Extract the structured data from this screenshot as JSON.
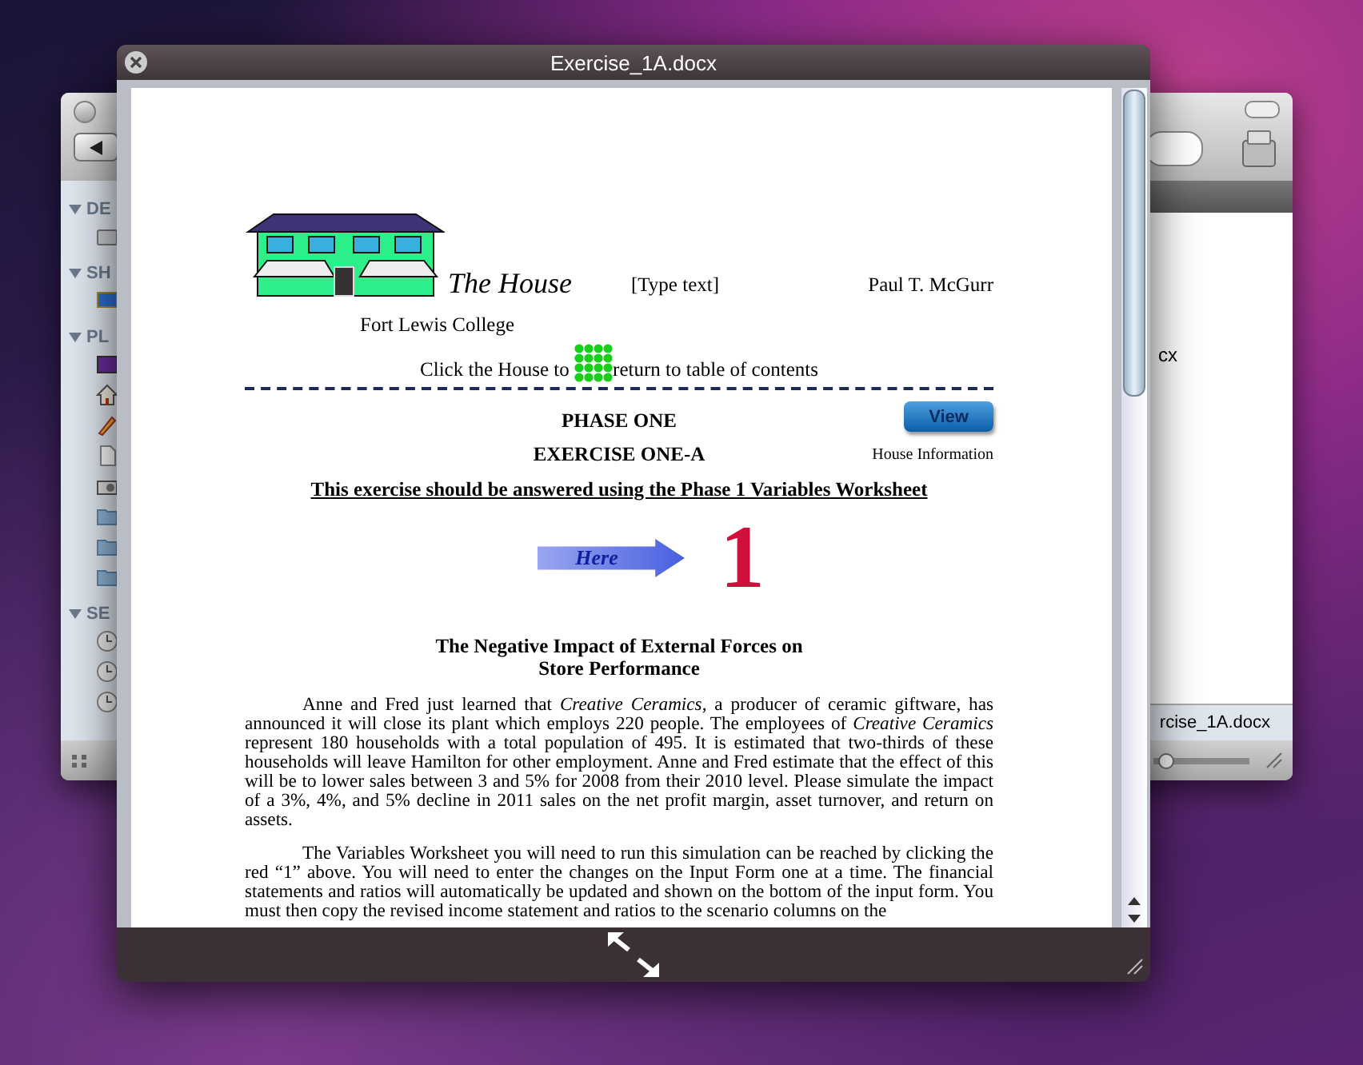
{
  "finder_window": {
    "sidebar_sections": [
      {
        "label": "DE",
        "expanded": true
      },
      {
        "label": "SH",
        "expanded": true
      },
      {
        "label": "PL",
        "expanded": true
      },
      {
        "label": "SE",
        "expanded": true
      }
    ],
    "file_label": "cx",
    "path_text": "rcise_1A.docx",
    "zoom_slider": {
      "level": 0.05
    }
  },
  "quicklook": {
    "title": "Exercise_1A.docx"
  },
  "document": {
    "header": {
      "title": "The House",
      "header_text": "[Type text]",
      "author": "Paul T. McGurr"
    },
    "college": "Fort Lewis College",
    "nav_line": {
      "before": "Click the House to",
      "after": "return to table of contents"
    },
    "phase": "PHASE ONE",
    "view_button": "View",
    "exercise": "EXERCISE ONE-A",
    "house_info": "House Information",
    "instruction": "This exercise should be answered using the Phase 1 Variables Worksheet",
    "here_button": "Here",
    "red_numeral": "1",
    "section_title": [
      "The Negative Impact of External Forces on",
      "Store Performance"
    ],
    "paragraphs": [
      "Anne and Fred just learned that *Creative Ceramics*, a producer of ceramic giftware, has announced it will close its plant which employs 220 people. The employees of *Creative Ceramics* represent 180 households with a total population of 495. It is estimated that two-thirds of these households will leave Hamilton for other employment.  Anne and Fred estimate that the effect of this will be to lower sales between 3 and 5% for 2008 from their 2010 level. Please simulate the impact of a 3%, 4%, and 5% decline in 2011 sales on the net profit margin, asset turnover, and return on assets.",
      "The Variables Worksheet you will need to run this simulation can be reached by clicking the red “1” above.  You will need to enter the changes on the Input Form one at a time. The financial statements and ratios will automatically be updated and shown on the bottom of the input form. You must then copy the revised income statement and ratios to the scenario columns on the"
    ]
  }
}
